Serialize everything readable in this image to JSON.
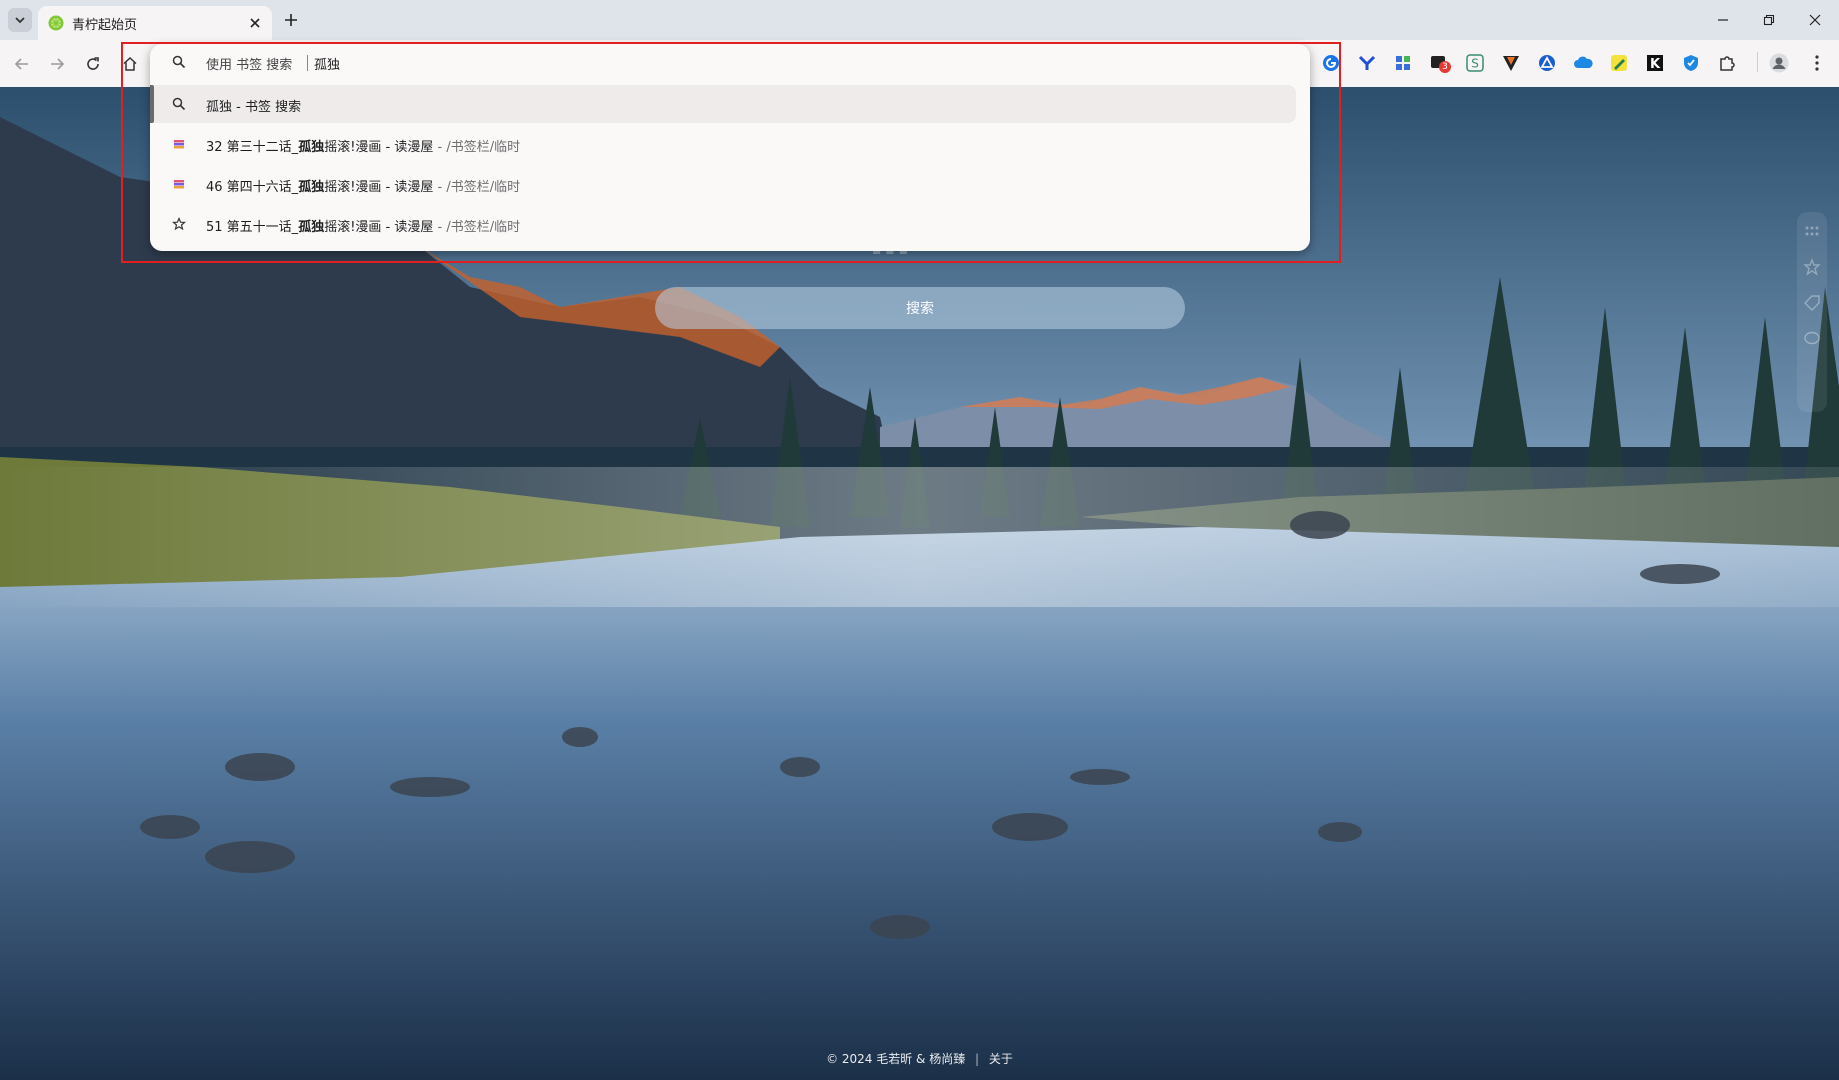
{
  "tab": {
    "title": "青柠起始页"
  },
  "omnibox": {
    "keyword_label": "使用 书签 搜索",
    "query": "孤独",
    "suggestions": [
      {
        "icon": "search-icon",
        "bold": "孤独",
        "text": " - 书签 搜索",
        "dim": "",
        "selected": true
      },
      {
        "icon": "book-icon",
        "prefix": "32 第三十二话_",
        "bold": "孤独",
        "text": "摇滚!漫画 - 读漫屋",
        "dim": " - /书签栏/临时",
        "selected": false
      },
      {
        "icon": "book-icon",
        "prefix": "46 第四十六话_",
        "bold": "孤独",
        "text": "摇滚!漫画 - 读漫屋",
        "dim": " - /书签栏/临时",
        "selected": false
      },
      {
        "icon": "star-icon",
        "prefix": "51 第五十一话_",
        "bold": "孤独",
        "text": "摇滚!漫画 - 读漫屋",
        "dim": " - /书签栏/临时",
        "selected": false
      }
    ]
  },
  "page": {
    "search_button": "搜索",
    "footer_copyright": "© 2024 毛若昕 & 杨尚臻",
    "footer_about": "关于"
  },
  "extensions": {
    "badge_count": "3",
    "icons": [
      "google-icon",
      "vpn-icon",
      "apps-icon",
      "badge-ext-icon",
      "s-ext-icon",
      "v-ext-icon",
      "triangle-ext-icon",
      "cloud-ext-icon",
      "pen-ext-icon",
      "k-ext-icon",
      "shield-ext-icon",
      "puzzle-icon",
      "profile-icon",
      "menu-icon"
    ]
  },
  "colors": {
    "highlight": "#e02020",
    "tabstrip": "#dfe3ea",
    "toolbar": "#f6f4f4"
  }
}
